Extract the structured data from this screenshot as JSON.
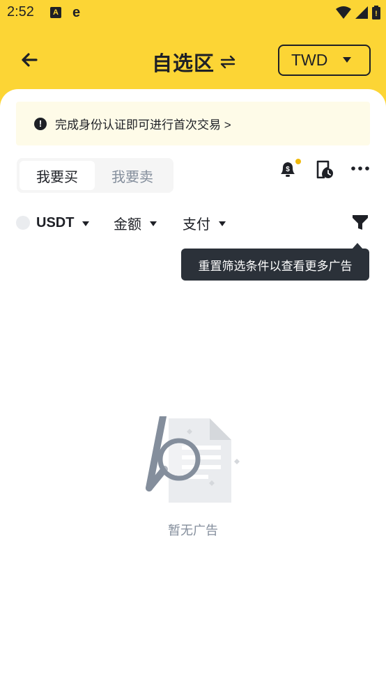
{
  "status_bar": {
    "time": "2:52",
    "icons": [
      "a-notification-icon",
      "e-browser-icon",
      "wifi-icon",
      "signal-icon",
      "battery-icon"
    ]
  },
  "header": {
    "title": "自选区",
    "currency": "TWD",
    "icons": [
      "back-arrow-icon",
      "swap-icon",
      "caret-down-icon"
    ]
  },
  "notice": {
    "text": "完成身份认证即可进行首次交易 >",
    "icon": "exclamation-icon"
  },
  "tabs": [
    {
      "label": "我要买",
      "active": true
    },
    {
      "label": "我要卖",
      "active": false
    }
  ],
  "toolbar": {
    "icons": [
      "alert-bell-icon",
      "order-history-icon",
      "more-icon"
    ],
    "badge_color": "#f0b90b"
  },
  "filters": {
    "coin": "USDT",
    "amount": "金额",
    "payment": "支付",
    "icon": "filter-funnel-icon"
  },
  "tooltip": {
    "text": "重置筛选条件以查看更多广告"
  },
  "empty_state": {
    "text": "暂无广告",
    "icon": "empty-search-document-icon"
  },
  "colors": {
    "brand": "#fcd535",
    "text": "#1e2026",
    "muted": "#848e9c",
    "tooltip_bg": "#2b3139"
  }
}
